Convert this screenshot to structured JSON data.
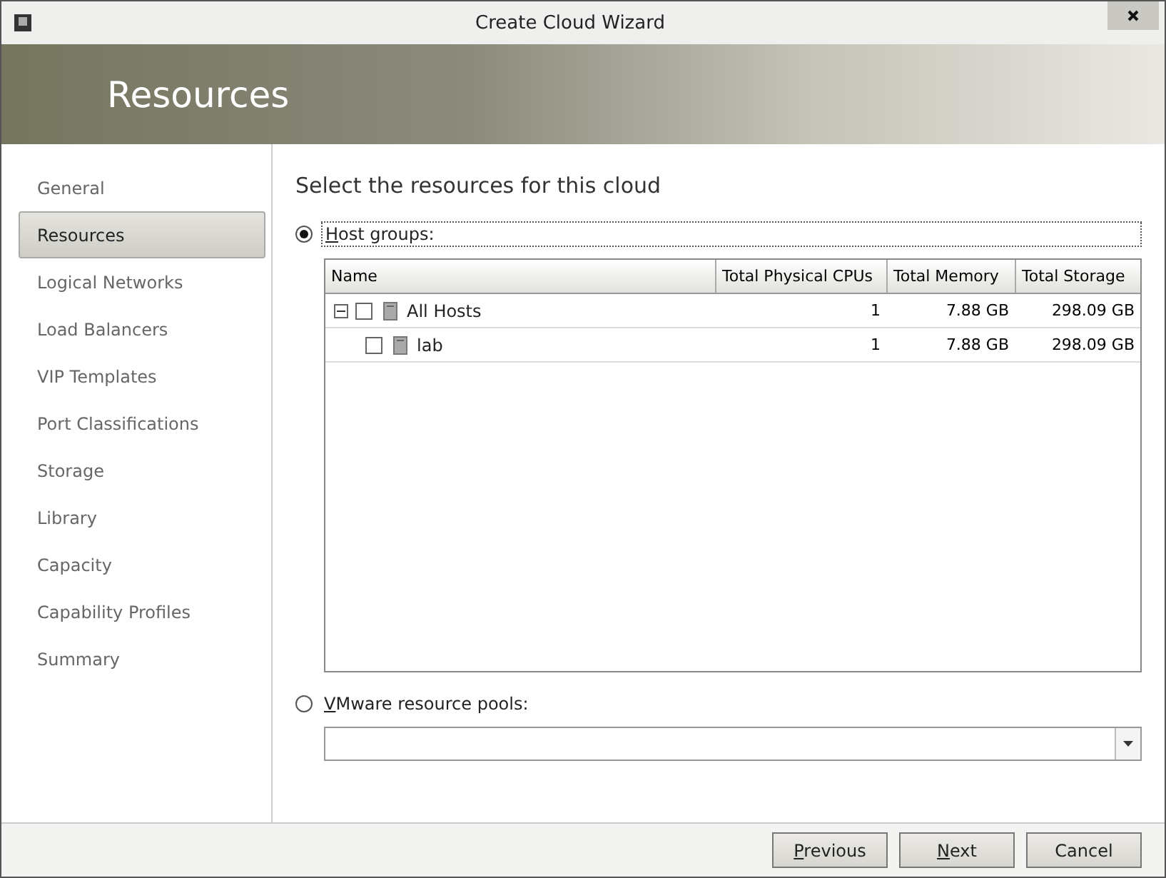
{
  "window": {
    "title": "Create Cloud Wizard"
  },
  "header": {
    "title": "Resources"
  },
  "sidebar": {
    "items": [
      {
        "label": "General",
        "selected": false
      },
      {
        "label": "Resources",
        "selected": true
      },
      {
        "label": "Logical Networks",
        "selected": false
      },
      {
        "label": "Load Balancers",
        "selected": false
      },
      {
        "label": "VIP Templates",
        "selected": false
      },
      {
        "label": "Port Classifications",
        "selected": false
      },
      {
        "label": "Storage",
        "selected": false
      },
      {
        "label": "Library",
        "selected": false
      },
      {
        "label": "Capacity",
        "selected": false
      },
      {
        "label": "Capability Profiles",
        "selected": false
      },
      {
        "label": "Summary",
        "selected": false
      }
    ]
  },
  "main": {
    "heading": "Select the resources for this cloud",
    "host_groups": {
      "label": "Host groups:",
      "selected": true,
      "mnemonic": true
    },
    "table": {
      "columns": [
        "Name",
        "Total Physical CPUs",
        "Total Memory",
        "Total Storage"
      ],
      "rows": [
        {
          "name": "All Hosts",
          "checked": false,
          "expanded": true,
          "cpus": "1",
          "memory": "7.88 GB",
          "storage": "298.09 GB",
          "children": [
            {
              "name": "lab",
              "checked": false,
              "cpus": "1",
              "memory": "7.88 GB",
              "storage": "298.09 GB"
            }
          ]
        }
      ]
    },
    "vmware": {
      "label": "VMware resource pools:",
      "selected": false,
      "mnemonic": true
    }
  },
  "buttons": [
    {
      "label": "Previous",
      "mnemonic": true
    },
    {
      "label": "Next",
      "mnemonic": true
    },
    {
      "label": "Cancel",
      "mnemonic": false
    }
  ]
}
